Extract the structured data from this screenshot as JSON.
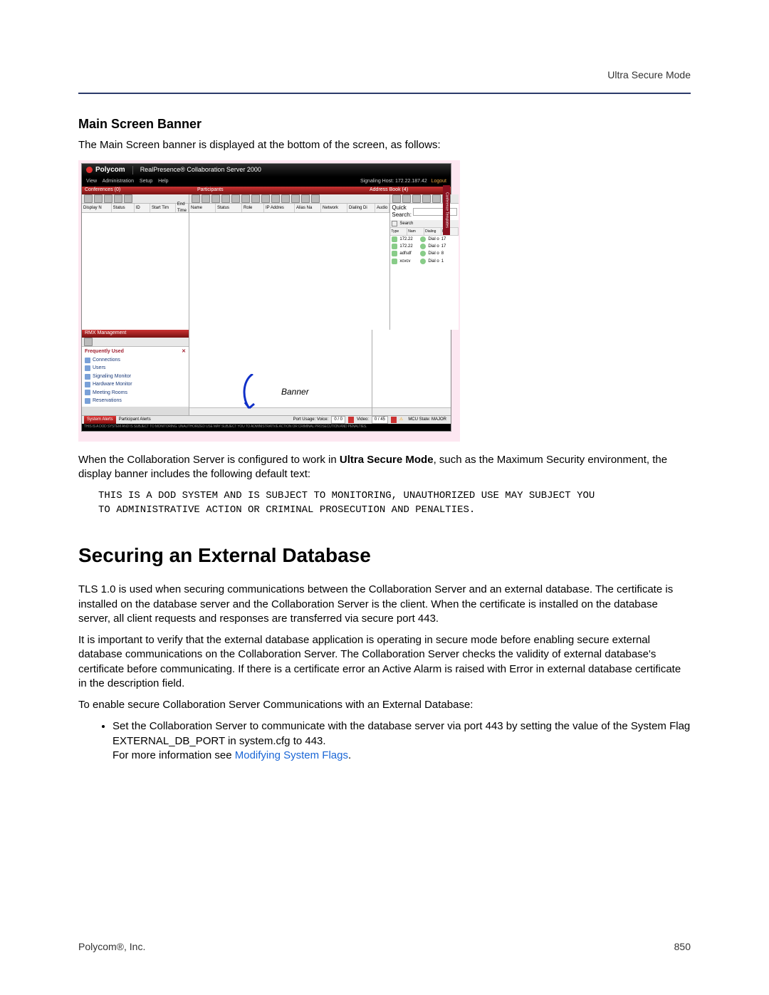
{
  "header": {
    "section": "Ultra Secure Mode"
  },
  "sec1": {
    "title": "Main Screen Banner",
    "intro": "The Main Screen banner is displayed at the bottom of the screen, as follows:",
    "after1a": "When the Collaboration Server is configured to work in ",
    "after1b": "Ultra Secure Mode",
    "after1c": ", such as the Maximum Security environment, the display banner includes the following default text:",
    "monotext": "THIS IS A DOD SYSTEM AND IS SUBJECT TO MONITORING, UNAUTHORIZED USE MAY SUBJECT YOU\nTO ADMINISTRATIVE ACTION OR CRIMINAL PROSECUTION AND PENALTIES."
  },
  "sec2": {
    "title": "Securing an External Database",
    "p1": "TLS 1.0 is used when securing communications between the Collaboration Server and an external database. The certificate is installed on the database server and the Collaboration Server is the client. When the certificate is installed on the database server, all client requests and responses are transferred via secure port 443.",
    "p2": "It is important to verify that the external database application is operating in secure mode before enabling secure external database communications on the Collaboration Server. The Collaboration Server checks the validity of external database's certificate before communicating. If there is a certificate error an Active Alarm is raised with Error in external database certificate in the description field.",
    "p3": "To enable secure Collaboration Server Communications with an External Database:",
    "bullet1": "Set the Collaboration Server to communicate with the database server via port 443 by setting the value of the System Flag EXTERNAL_DB_PORT in system.cfg to 443.",
    "bullet2a": "For more information see ",
    "bullet2b": "Modifying System Flags",
    "bullet2c": "."
  },
  "footer": {
    "left": "Polycom®, Inc.",
    "right": "850"
  },
  "shot": {
    "brand": "Polycom",
    "product": "RealPresence® Collaboration Server 2000",
    "menus": {
      "view": "View",
      "admin": "Administration",
      "setup": "Setup",
      "help": "Help"
    },
    "signaling": "Signaling Host: 172.22.187.42",
    "logout": "Logout",
    "panels": {
      "conferences": "Conferences (0)",
      "participants": "Participants",
      "addressbook": "Address Book (4)",
      "rmx": "RMX Management",
      "sidetab": "Conference Templates"
    },
    "conf_cols": {
      "disp": "Display N",
      "status": "Status",
      "id": "ID",
      "start": "Start Tim",
      "end": "End Time"
    },
    "part_cols": {
      "name": "Name",
      "status": "Status",
      "role": "Role",
      "ip": "IP Addres",
      "alias": "Alias Na",
      "net": "Network",
      "dial": "Dialing Di",
      "audio": "Audio"
    },
    "addr": {
      "quick": "Quick Search:",
      "search": "Search",
      "cols": {
        "type": "Type",
        "name": "Nam",
        "dial": "Dialing",
        "ip": "IP"
      },
      "rows": [
        {
          "name": "172.22",
          "dial": "Dial o",
          "ip": "17"
        },
        {
          "name": "172.22",
          "dial": "Dial o",
          "ip": "17"
        },
        {
          "name": "adfsdf",
          "dial": "Dial o",
          "ip": "8"
        },
        {
          "name": "xcvcv",
          "dial": "Dial o",
          "ip": "1"
        }
      ]
    },
    "rmx": {
      "freq": "Frequently Used",
      "items": [
        {
          "label": "Connections"
        },
        {
          "label": "Users"
        },
        {
          "label": "Signaling Monitor"
        },
        {
          "label": "Hardware Monitor"
        },
        {
          "label": "Meeting Rooms"
        },
        {
          "label": "Reservations"
        }
      ]
    },
    "banner_label": "Banner",
    "status": {
      "sys": "System Alerts",
      "part": "Participant Alerts",
      "portlabel": "Port Usage:   Voice:",
      "voice": "0 / 0",
      "vidlabel": "Video:",
      "video": "0 / 45",
      "mcu": "MCU State: MAJOR"
    },
    "disclaimer": "THIS IS A DOD SYSTEM AND IS SUBJECT TO MONITORING. UNAUTHORIZED USE MAY SUBJECT YOU TO ADMINISTRATIVE ACTION OR CRIMINAL PROSECUTION AND PENALTIES."
  }
}
